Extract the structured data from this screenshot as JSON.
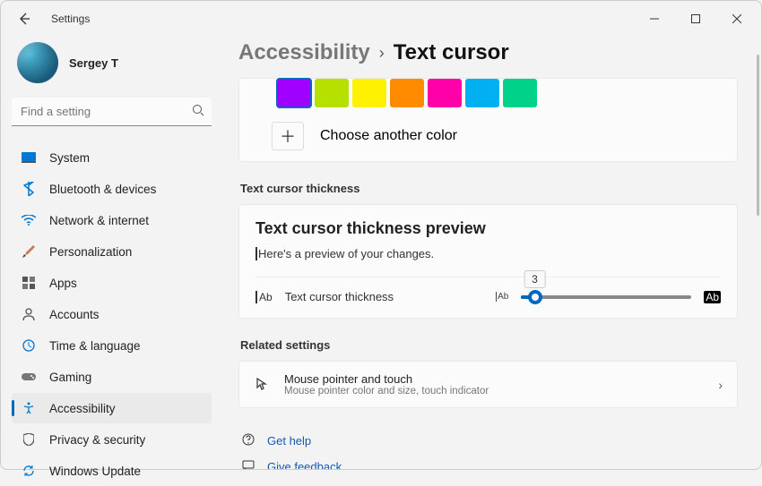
{
  "app_title": "Settings",
  "user": {
    "name": "Sergey T"
  },
  "search": {
    "placeholder": "Find a setting"
  },
  "sidebar": {
    "items": [
      {
        "label": "System"
      },
      {
        "label": "Bluetooth & devices"
      },
      {
        "label": "Network & internet"
      },
      {
        "label": "Personalization"
      },
      {
        "label": "Apps"
      },
      {
        "label": "Accounts"
      },
      {
        "label": "Time & language"
      },
      {
        "label": "Gaming"
      },
      {
        "label": "Accessibility"
      },
      {
        "label": "Privacy & security"
      },
      {
        "label": "Windows Update"
      }
    ]
  },
  "breadcrumb": {
    "parent": "Accessibility",
    "current": "Text cursor"
  },
  "colors": {
    "swatches": [
      "#a000ff",
      "#b5e000",
      "#fff100",
      "#ff8c00",
      "#ff00a8",
      "#00b0f0",
      "#00d28a"
    ],
    "choose_label": "Choose another color"
  },
  "thickness": {
    "section": "Text cursor thickness",
    "preview_title": "Text cursor thickness preview",
    "preview_text": "Here's a preview of your changes.",
    "row_label": "Text cursor thickness",
    "value": "3",
    "min_glyph": "Ab",
    "max_glyph": "Ab"
  },
  "related": {
    "section": "Related settings",
    "mouse": {
      "title": "Mouse pointer and touch",
      "desc": "Mouse pointer color and size, touch indicator"
    }
  },
  "help": {
    "get": "Get help",
    "feedback": "Give feedback"
  }
}
